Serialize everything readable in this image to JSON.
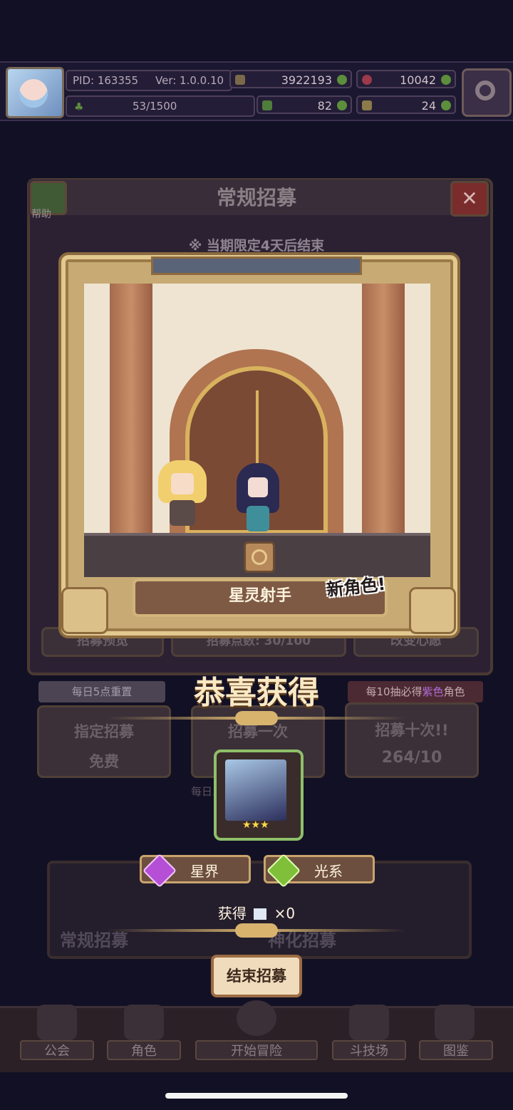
{
  "status": {
    "pid": "PID: 163355",
    "version": "Ver: 1.0.0.10",
    "xp": "53/1500",
    "gold": "3922193",
    "ruby": "10042",
    "clover": "82",
    "key": "24"
  },
  "panel": {
    "title": "常规招募",
    "help_label": "帮助",
    "notice": "※ 当期限定4天后结束",
    "close_label": "✕"
  },
  "scene": {
    "character_name": "星灵射手",
    "new_tag": "新角色!"
  },
  "background_buttons": {
    "preview": "招募预览",
    "points": "招募点数: 30/100",
    "change": "改变心愿",
    "daily_reset": "每日5点重置",
    "ten_guarantee_prefix": "每10抽必得",
    "ten_guarantee_color": "紫色",
    "ten_guarantee_suffix": "角色",
    "designate": "指定招募",
    "free": "免费",
    "once": "招募一次",
    "ten": "招募十次!!",
    "ten_cost": "264/10",
    "daily_limit": "每日...999",
    "banner_left": "常规招募",
    "banner_right": "神化招募"
  },
  "result": {
    "congrats": "恭喜获得",
    "stars": "★★★",
    "element1": "星界",
    "element2": "光系",
    "obtain_label": "获得",
    "obtain_count": "×0",
    "end_button": "结束招募"
  },
  "nav": {
    "guild": "公会",
    "character": "角色",
    "adventure": "开始冒险",
    "arena": "斗技场",
    "codex": "图鉴"
  },
  "colors": {
    "accent_gold": "#d7b36e",
    "purple": "#b06bd6",
    "green_frame": "#8fbf6a"
  }
}
